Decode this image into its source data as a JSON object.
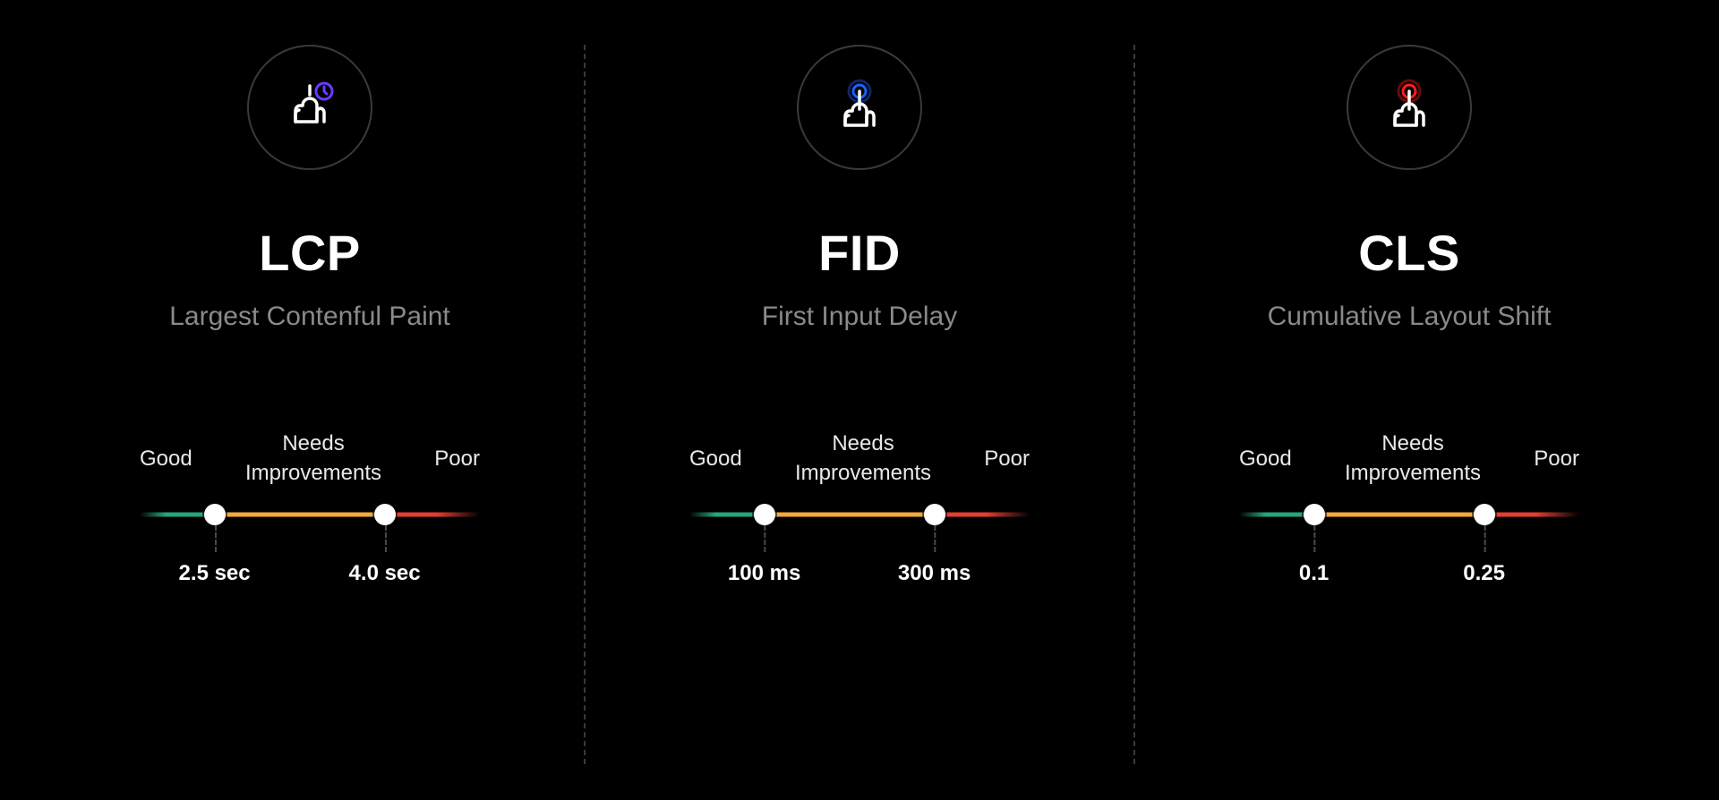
{
  "scale_labels": {
    "good": "Good",
    "needs_line1": "Needs",
    "needs_line2": "Improvements",
    "poor": "Poor"
  },
  "metrics": [
    {
      "id": "lcp",
      "abbrev": "LCP",
      "name": "Largest Contenful Paint",
      "icon": "hand-clock",
      "accent": "#6a3bff",
      "threshold_good": "2.5 sec",
      "threshold_poor": "4.0 sec"
    },
    {
      "id": "fid",
      "abbrev": "FID",
      "name": "First Input Delay",
      "icon": "hand-tap",
      "accent": "#1d5fff",
      "threshold_good": "100 ms",
      "threshold_poor": "300 ms"
    },
    {
      "id": "cls",
      "abbrev": "CLS",
      "name": "Cumulative Layout Shift",
      "icon": "hand-tap",
      "accent": "#ff1d1d",
      "threshold_good": "0.1",
      "threshold_poor": "0.25"
    }
  ],
  "colors": {
    "good": "#26a678",
    "needs": "#f2a93b",
    "poor": "#e43c2f"
  }
}
